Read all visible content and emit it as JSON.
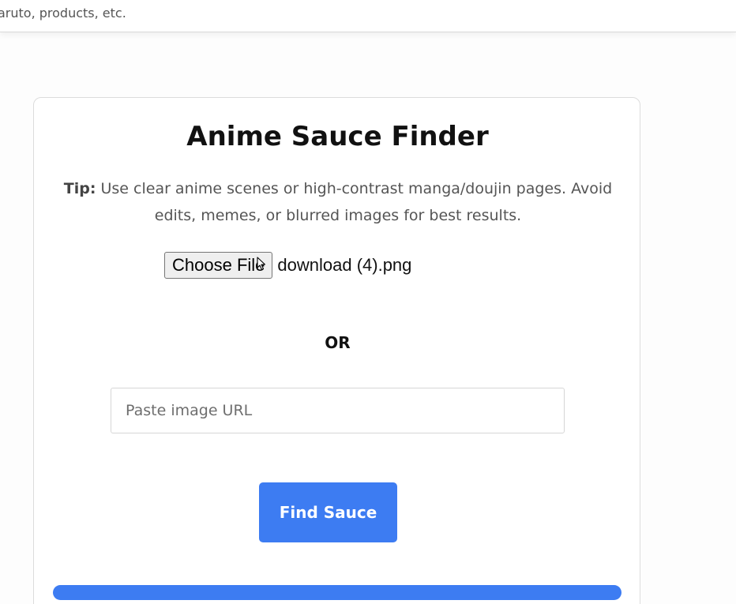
{
  "top_bar": {
    "text": "aruto, products, etc."
  },
  "card": {
    "title": "Anime Sauce Finder",
    "tip_label": "Tip:",
    "tip_text": " Use clear anime scenes or high-contrast manga/doujin pages. Avoid edits, memes, or blurred images for best results.",
    "file_input": {
      "button_label": "Choose File",
      "file_name": "download (4).png"
    },
    "or_label": "OR",
    "url_input": {
      "placeholder": "Paste image URL",
      "value": ""
    },
    "find_button_label": "Find Sauce",
    "progress": 1.0
  },
  "colors": {
    "accent": "#3d7cf2"
  },
  "icons": [
    "cursor-icon"
  ]
}
